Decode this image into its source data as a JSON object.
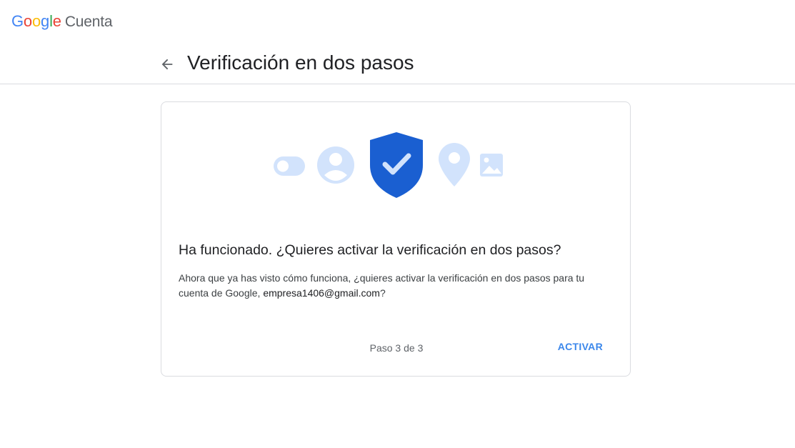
{
  "brand": {
    "letters": [
      "G",
      "o",
      "o",
      "g",
      "l",
      "e"
    ],
    "product": "Cuenta"
  },
  "header": {
    "back_icon": "arrow-back-icon",
    "title": "Verificación en dos pasos"
  },
  "card": {
    "illustration_icons": [
      "toggle-icon",
      "account-circle-icon",
      "shield-check-icon",
      "location-pin-icon",
      "image-icon"
    ],
    "heading": "Ha funcionado. ¿Quieres activar la verificación en dos pasos?",
    "body_text": "Ahora que ya has visto cómo funciona, ¿quieres activar la verificación en dos pasos para tu cuenta de Google, ",
    "email": "empresa1406@gmail.com",
    "body_suffix": "?",
    "step": "Paso 3 de 3",
    "activate_label": "ACTIVAR"
  },
  "colors": {
    "accent": "#1a73e8",
    "shield": "#1a5fd1",
    "light_icon": "#d2e3fc"
  }
}
